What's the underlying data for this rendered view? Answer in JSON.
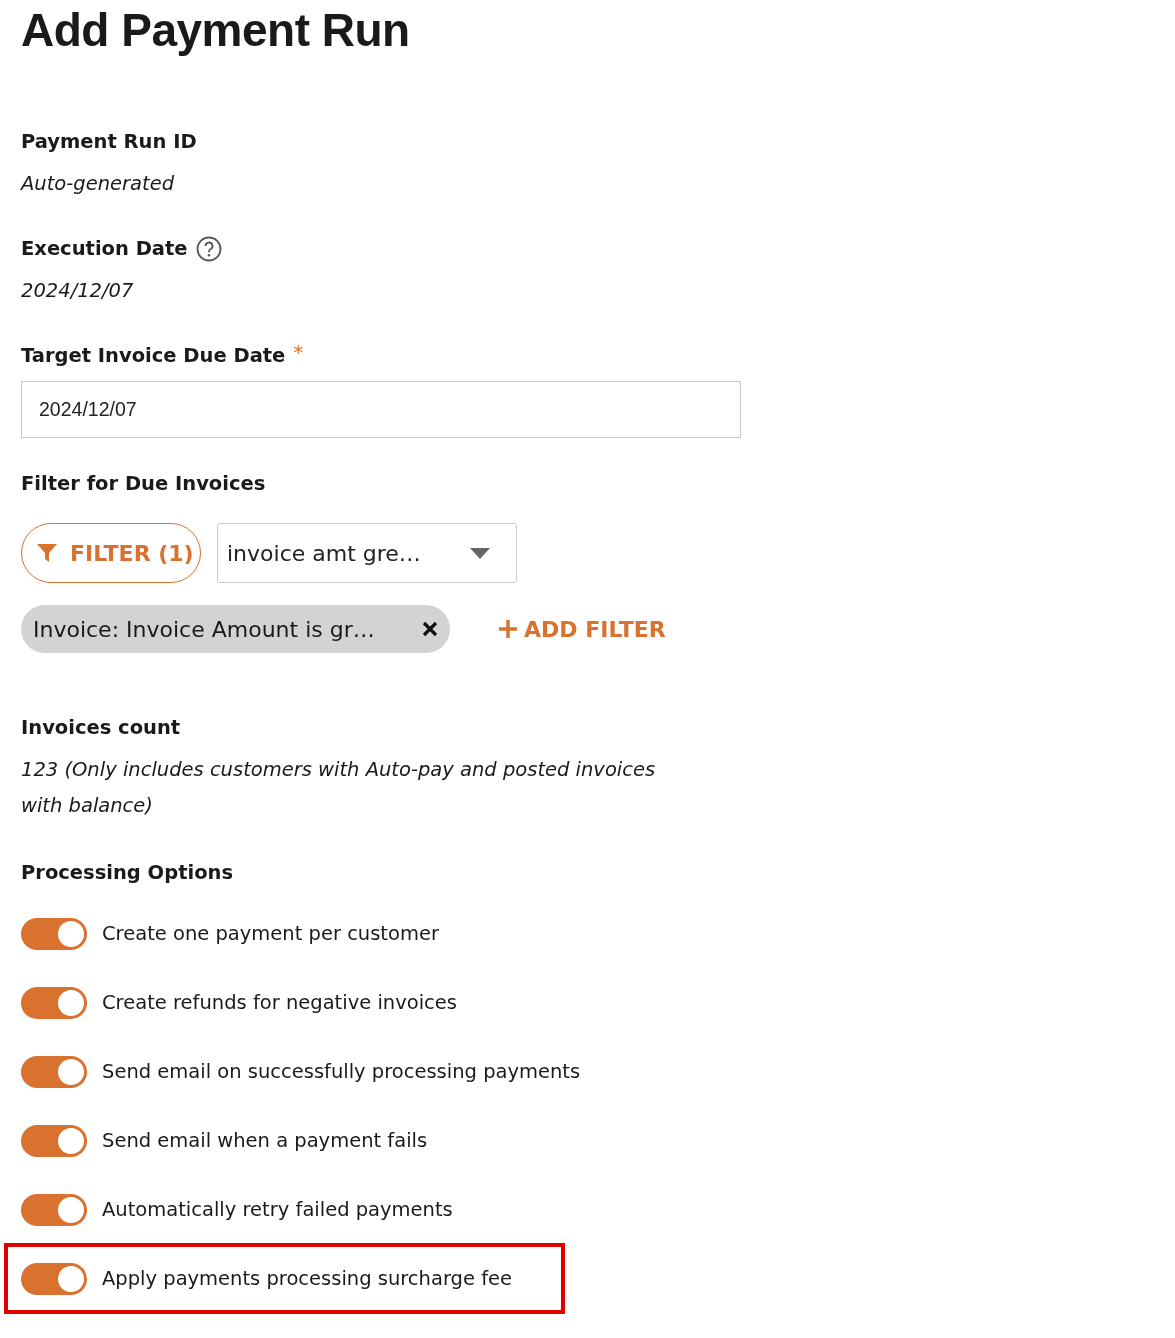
{
  "title": "Add Payment Run",
  "fields": [
    {
      "kind": "text",
      "label": "Payment Run ID",
      "value": "Auto-generated"
    },
    {
      "kind": "text",
      "label": "Execution Date",
      "help": true,
      "value": "2024/12/07"
    },
    {
      "kind": "input",
      "label": "Target Invoice Due Date",
      "required_mark": "*",
      "value": "2024/12/07"
    }
  ],
  "filter": {
    "label": "Filter for Due Invoices",
    "button": "FILTER (1)",
    "dropdown": "invoice amt gre…",
    "chip": "Invoice: Invoice Amount is gr…",
    "add_button": "ADD FILTER"
  },
  "count": {
    "label": "Invoices count",
    "value": "123 (Only includes customers with Auto-pay and posted invoices with balance)"
  },
  "processing": {
    "label": "Processing Options",
    "items": [
      {
        "label": "Create one payment per customer",
        "on": true
      },
      {
        "label": "Create refunds for negative invoices",
        "on": true
      },
      {
        "label": "Send email on successfully processing payments",
        "on": true
      },
      {
        "label": "Send email when a payment fails",
        "on": true
      },
      {
        "label": "Automatically retry failed payments",
        "on": true
      },
      {
        "label": "Apply payments processing surcharge fee",
        "on": true,
        "highlighted": true
      }
    ]
  }
}
